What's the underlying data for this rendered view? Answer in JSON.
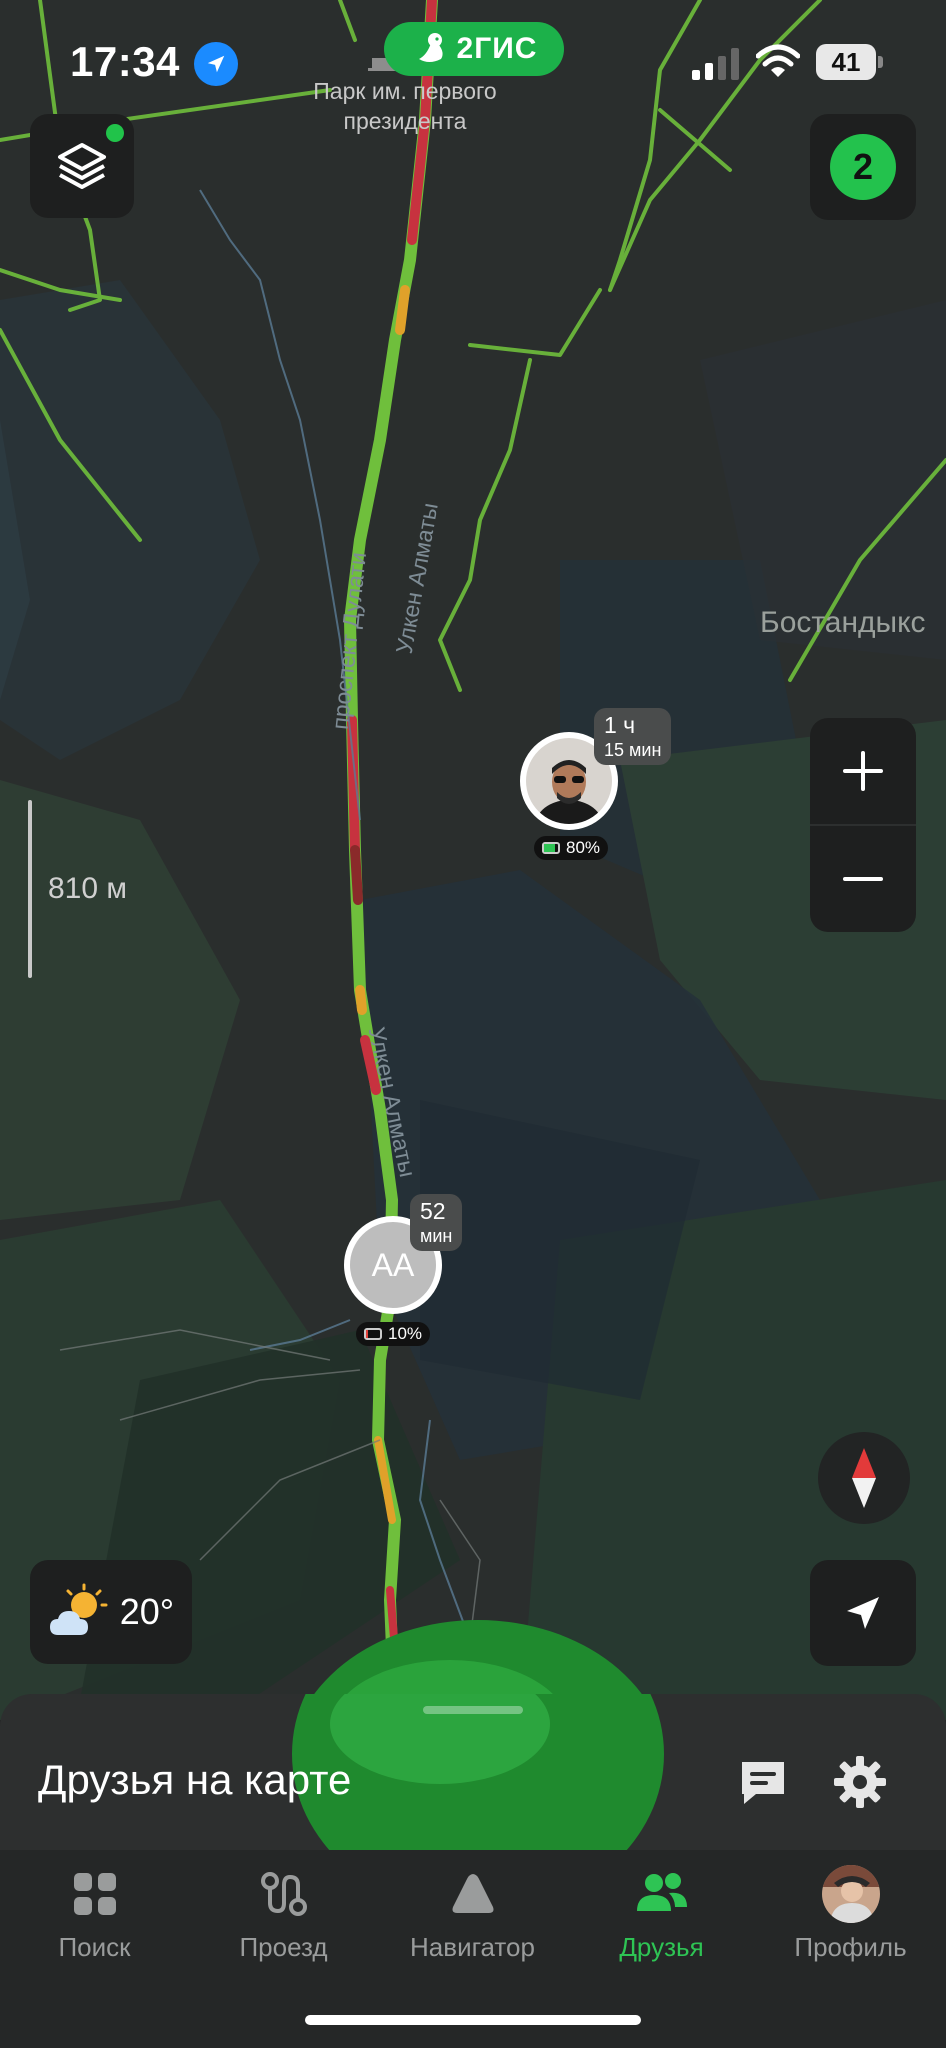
{
  "status_bar": {
    "time": "17:34",
    "battery": "41",
    "brand": "2ГИС"
  },
  "map": {
    "poi_label": "Парк им. первого президента",
    "district_label": "Бостандыкс",
    "street_1": "проспект Дулати",
    "street_2": "Улкен Алматы",
    "street_3": "Улкен Алматы",
    "scale": "810 м"
  },
  "controls": {
    "friends_count": "2",
    "zoom_in_icon": "plus-icon",
    "zoom_out_icon": "minus-icon",
    "compass_icon": "compass-icon",
    "locate_icon": "navigation-arrow-icon",
    "layers_icon": "layers-icon"
  },
  "weather": {
    "temperature": "20°",
    "icon": "partly-cloudy-icon"
  },
  "friends": [
    {
      "initials": "",
      "time_main": "1 ч",
      "time_sub": "15 мин",
      "battery": "80%",
      "battery_color": "#2ec454",
      "battery_level": 0.8
    },
    {
      "initials": "АА",
      "time_main": "52",
      "time_sub": "мин",
      "battery": "10%",
      "battery_color": "#e0413a",
      "battery_level": 0.1
    }
  ],
  "sheet": {
    "title": "Друзья на карте",
    "chat_icon": "chat-icon",
    "settings_icon": "gear-icon"
  },
  "tabs": [
    {
      "label": "Поиск",
      "icon": "grid-icon"
    },
    {
      "label": "Проезд",
      "icon": "route-icon"
    },
    {
      "label": "Навигатор",
      "icon": "navigator-icon"
    },
    {
      "label": "Друзья",
      "icon": "friends-icon",
      "active": true
    },
    {
      "label": "Профиль",
      "icon": "profile-avatar"
    }
  ],
  "colors": {
    "accent_green": "#2ec454",
    "traffic_red": "#c7323f",
    "traffic_yellow": "#e0a12a",
    "road_green": "#6fbf3c"
  }
}
